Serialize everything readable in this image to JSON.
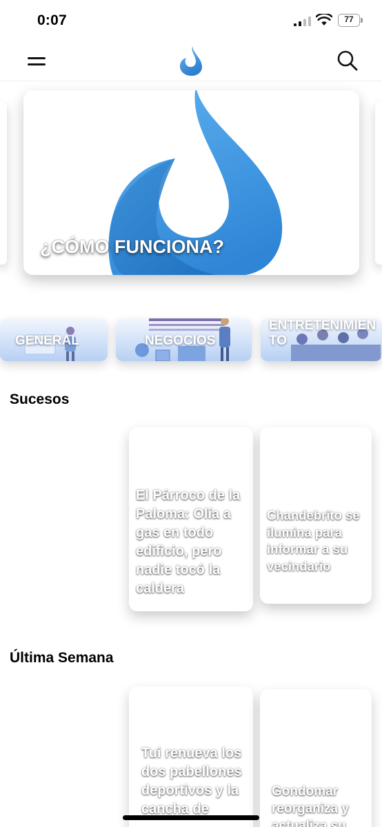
{
  "status_bar": {
    "time": "0:07",
    "battery": "77"
  },
  "header": {
    "menu_icon": "menu-icon",
    "logo_icon": "drop-logo-icon",
    "search_icon": "search-icon"
  },
  "hero": {
    "title": "¿CÓMO FUNCIONA?",
    "accent": "#3f9be6"
  },
  "categories": [
    {
      "label": "GENERAL"
    },
    {
      "label": "NEGOCIOS"
    },
    {
      "label": "ENTRETENIMIENTO"
    }
  ],
  "sections": [
    {
      "title": "Sucesos",
      "cards": [
        {
          "title": "El Párroco de la Paloma: Olía a gas en todo edificio, pero nadie tocó la caldera"
        },
        {
          "title": "Chandebrito se ilumina para informar a su vecindario"
        }
      ]
    },
    {
      "title": "Última Semana",
      "cards": [
        {
          "title": "Tui renueva los dos pabellones deportivos y la cancha de"
        },
        {
          "title": "Gondomar reorganiza y actualiza su"
        }
      ]
    }
  ]
}
